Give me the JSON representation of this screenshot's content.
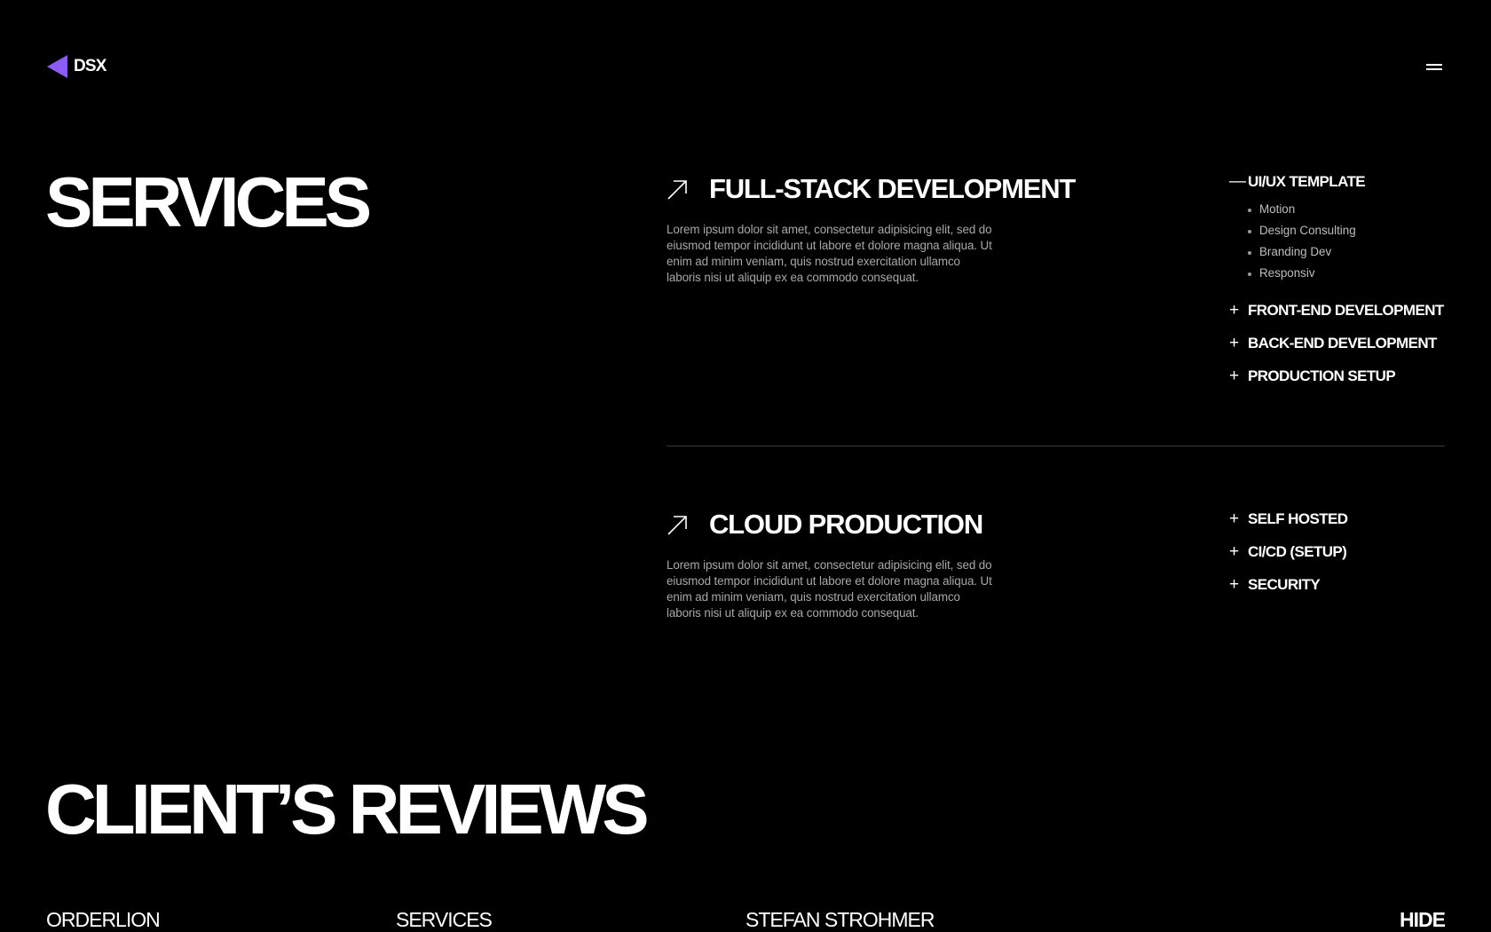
{
  "header": {
    "logo_text": "DSX",
    "brand_color": "#8b5cf6",
    "menu_icon": "hamburger-menu-icon"
  },
  "services": {
    "title": "SERVICES",
    "items": [
      {
        "title": "FULL-STACK DEVELOPMENT",
        "description": "Lorem ipsum dolor sit amet, consectetur adipisicing elit, sed do eiusmod tempor incididunt ut labore et dolore magna aliqua. Ut enim ad minim veniam, quis nostrud exercitation ullamco laboris nisi ut aliquip ex ea commodo consequat.",
        "categories": [
          {
            "label": "UI/UX TEMPLATE",
            "expanded": true,
            "sign": "—",
            "subitems": [
              "Motion",
              "Design Consulting",
              "Branding Dev",
              "Responsiv"
            ]
          },
          {
            "label": "FRONT-END DEVELOPMENT",
            "expanded": false,
            "sign": "+"
          },
          {
            "label": "BACK-END DEVELOPMENT",
            "expanded": false,
            "sign": "+"
          },
          {
            "label": "PRODUCTION SETUP",
            "expanded": false,
            "sign": "+"
          }
        ]
      },
      {
        "title": "CLOUD PRODUCTION",
        "description": "Lorem ipsum dolor sit amet, consectetur adipisicing elit, sed do eiusmod tempor incididunt ut labore et dolore magna aliqua. Ut enim ad minim veniam, quis nostrud exercitation ullamco laboris nisi ut aliquip ex ea commodo consequat.",
        "categories": [
          {
            "label": "SELF HOSTED",
            "expanded": false,
            "sign": "+"
          },
          {
            "label": "CI/CD (SETUP)",
            "expanded": false,
            "sign": "+"
          },
          {
            "label": "SECURITY",
            "expanded": false,
            "sign": "+"
          }
        ]
      }
    ]
  },
  "reviews": {
    "title": "CLIENT’S REVIEWS",
    "row": {
      "client": "ORDERLION",
      "category": "SERVICES",
      "person": "STEFAN STROHMER",
      "toggle": "HIDE"
    }
  }
}
